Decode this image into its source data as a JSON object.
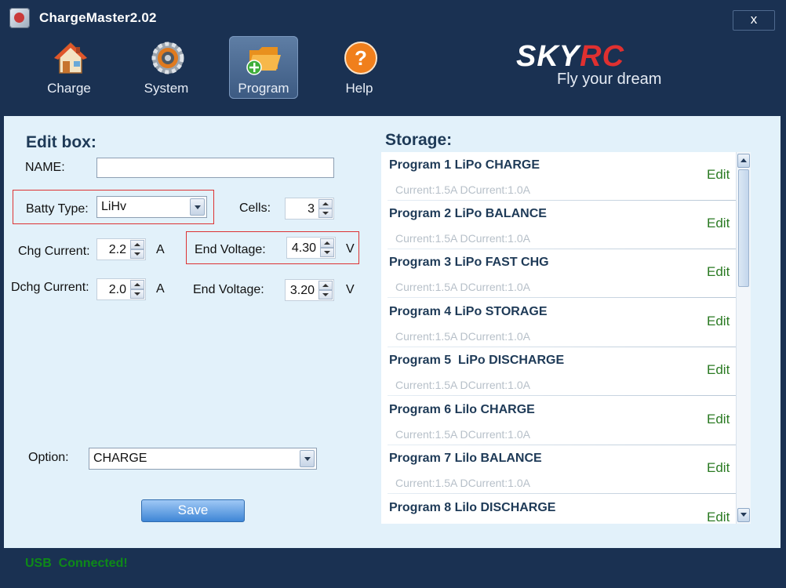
{
  "window": {
    "title": "ChargeMaster2.02",
    "close_label": "x"
  },
  "toolbar": {
    "items": [
      {
        "label": "Charge",
        "icon": "home-icon"
      },
      {
        "label": "System",
        "icon": "gear-icon"
      },
      {
        "label": "Program",
        "icon": "folder-add-icon",
        "active": true
      },
      {
        "label": "Help",
        "icon": "help-icon"
      }
    ]
  },
  "logo": {
    "brand_a": "SKY",
    "brand_b": "RC",
    "tagline": "Fly your dream"
  },
  "edit_box": {
    "title": "Edit box:",
    "name_label": "NAME:",
    "name_value": "",
    "batt_type_label": "Batty Type:",
    "batt_type_value": "LiHv",
    "cells_label": "Cells:",
    "cells_value": "3",
    "chg_current_label": "Chg Current:",
    "chg_current_value": "2.2",
    "chg_unit": "A",
    "chg_end_voltage_label": "End Voltage:",
    "chg_end_voltage_value": "4.30",
    "chg_end_unit": "V",
    "dchg_current_label": "Dchg Current:",
    "dchg_current_value": "2.0",
    "dchg_unit": "A",
    "dchg_end_voltage_label": "End Voltage:",
    "dchg_end_voltage_value": "3.20",
    "dchg_end_unit": "V",
    "option_label": "Option:",
    "option_value": "CHARGE",
    "save_label": "Save"
  },
  "storage": {
    "title": "Storage:",
    "programs": [
      {
        "title": "Program 1 LiPo CHARGE",
        "desc": "Current:1.5A  DCurrent:1.0A",
        "edit": "Edit"
      },
      {
        "title": "Program 2 LiPo BALANCE",
        "desc": "Current:1.5A  DCurrent:1.0A",
        "edit": "Edit"
      },
      {
        "title": "Program 3 LiPo FAST CHG",
        "desc": "Current:1.5A  DCurrent:1.0A",
        "edit": "Edit"
      },
      {
        "title": "Program 4 LiPo STORAGE",
        "desc": "Current:1.5A  DCurrent:1.0A",
        "edit": "Edit"
      },
      {
        "title": "Program 5  LiPo DISCHARGE",
        "desc": "Current:1.5A  DCurrent:1.0A",
        "edit": "Edit"
      },
      {
        "title": "Program 6 Lilo CHARGE",
        "desc": "Current:1.5A  DCurrent:1.0A",
        "edit": "Edit"
      },
      {
        "title": "Program 7 Lilo BALANCE",
        "desc": "Current:1.5A  DCurrent:1.0A",
        "edit": "Edit"
      },
      {
        "title": "Program 8 Lilo DISCHARGE",
        "desc": "",
        "edit": "Edit"
      }
    ]
  },
  "status": {
    "text": "USB  Connected!"
  },
  "colors": {
    "frame": "#1a3152",
    "panel": "#e2f1fa",
    "status_green": "#0e8a18",
    "edit_green": "#2a7a22",
    "highlight_red": "#dd3333"
  }
}
